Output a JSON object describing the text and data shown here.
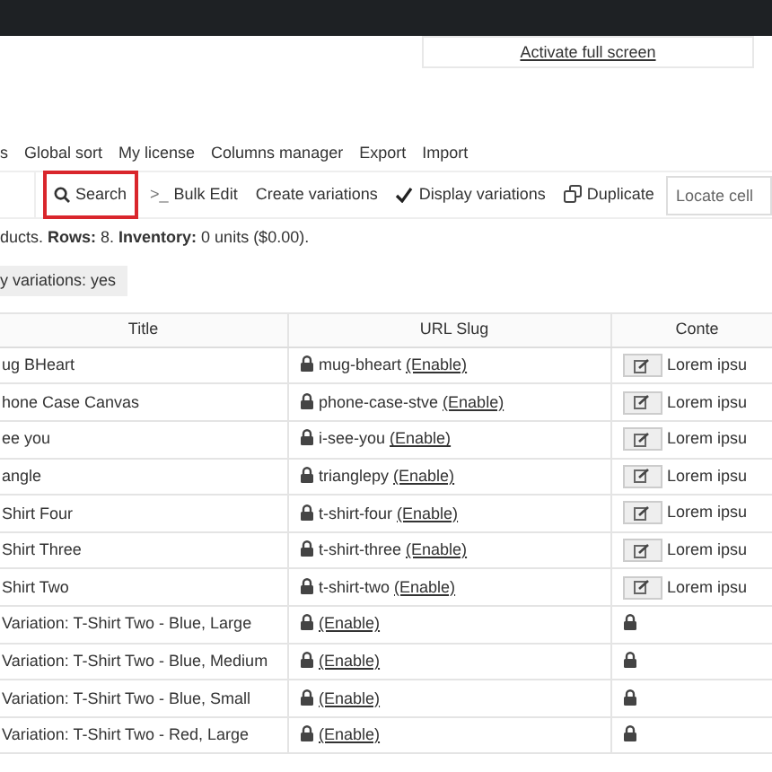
{
  "fullscreen_link": "Activate full screen",
  "menu": [
    "s",
    "Global sort",
    "My license",
    "Columns manager",
    "Export",
    "Import"
  ],
  "toolbar": [
    {
      "kind": "search",
      "label": "Search",
      "highlighted": true
    },
    {
      "kind": "bulk",
      "label": "Bulk Edit",
      "icon": ">_",
      "highlighted": false
    },
    {
      "kind": "plain",
      "label": "Create variations",
      "highlighted": false
    },
    {
      "kind": "check",
      "label": "Display variations",
      "highlighted": false
    },
    {
      "kind": "duplicate",
      "label": "Duplicate",
      "highlighted": false
    }
  ],
  "locate_field": {
    "placeholder": "Locate cell"
  },
  "summary": "ducts. **Rows:** 8. **Inventory:** 0 units ($0.00).",
  "filter_chip": "y variations: yes",
  "table": {
    "columns": [
      "Title",
      "URL Slug",
      "Conte"
    ],
    "rows": [
      {
        "kind": "product",
        "title": "ug BHeart",
        "slug": "mug-bheart",
        "link": "(Enable)",
        "content": "Lorem ipsu"
      },
      {
        "kind": "product",
        "title": "hone Case Canvas",
        "slug": "phone-case-stve",
        "link": "(Enable)",
        "content": "Lorem ipsu"
      },
      {
        "kind": "product",
        "title": "ee you",
        "slug": "i-see-you",
        "link": "(Enable)",
        "content": "Lorem ipsu"
      },
      {
        "kind": "product",
        "title": "angle",
        "slug": "trianglepy",
        "link": "(Enable)",
        "content": "Lorem ipsu"
      },
      {
        "kind": "product",
        "title": "Shirt Four",
        "slug": "t-shirt-four",
        "link": "(Enable)",
        "content": "Lorem ipsu"
      },
      {
        "kind": "product",
        "title": "Shirt Three",
        "slug": "t-shirt-three",
        "link": "(Enable)",
        "content": "Lorem ipsu"
      },
      {
        "kind": "product",
        "title": "Shirt Two",
        "slug": "t-shirt-two",
        "link": "(Enable)",
        "content": "Lorem ipsu"
      },
      {
        "kind": "variation",
        "title": "Variation: T-Shirt Two - Blue, Large",
        "link": "(Enable)"
      },
      {
        "kind": "variation",
        "title": "Variation: T-Shirt Two - Blue, Medium",
        "link": "(Enable)"
      },
      {
        "kind": "variation",
        "title": "Variation: T-Shirt Two - Blue, Small",
        "link": "(Enable)"
      },
      {
        "kind": "variation",
        "title": "Variation: T-Shirt Two - Red, Large",
        "link": "(Enable)"
      }
    ]
  }
}
